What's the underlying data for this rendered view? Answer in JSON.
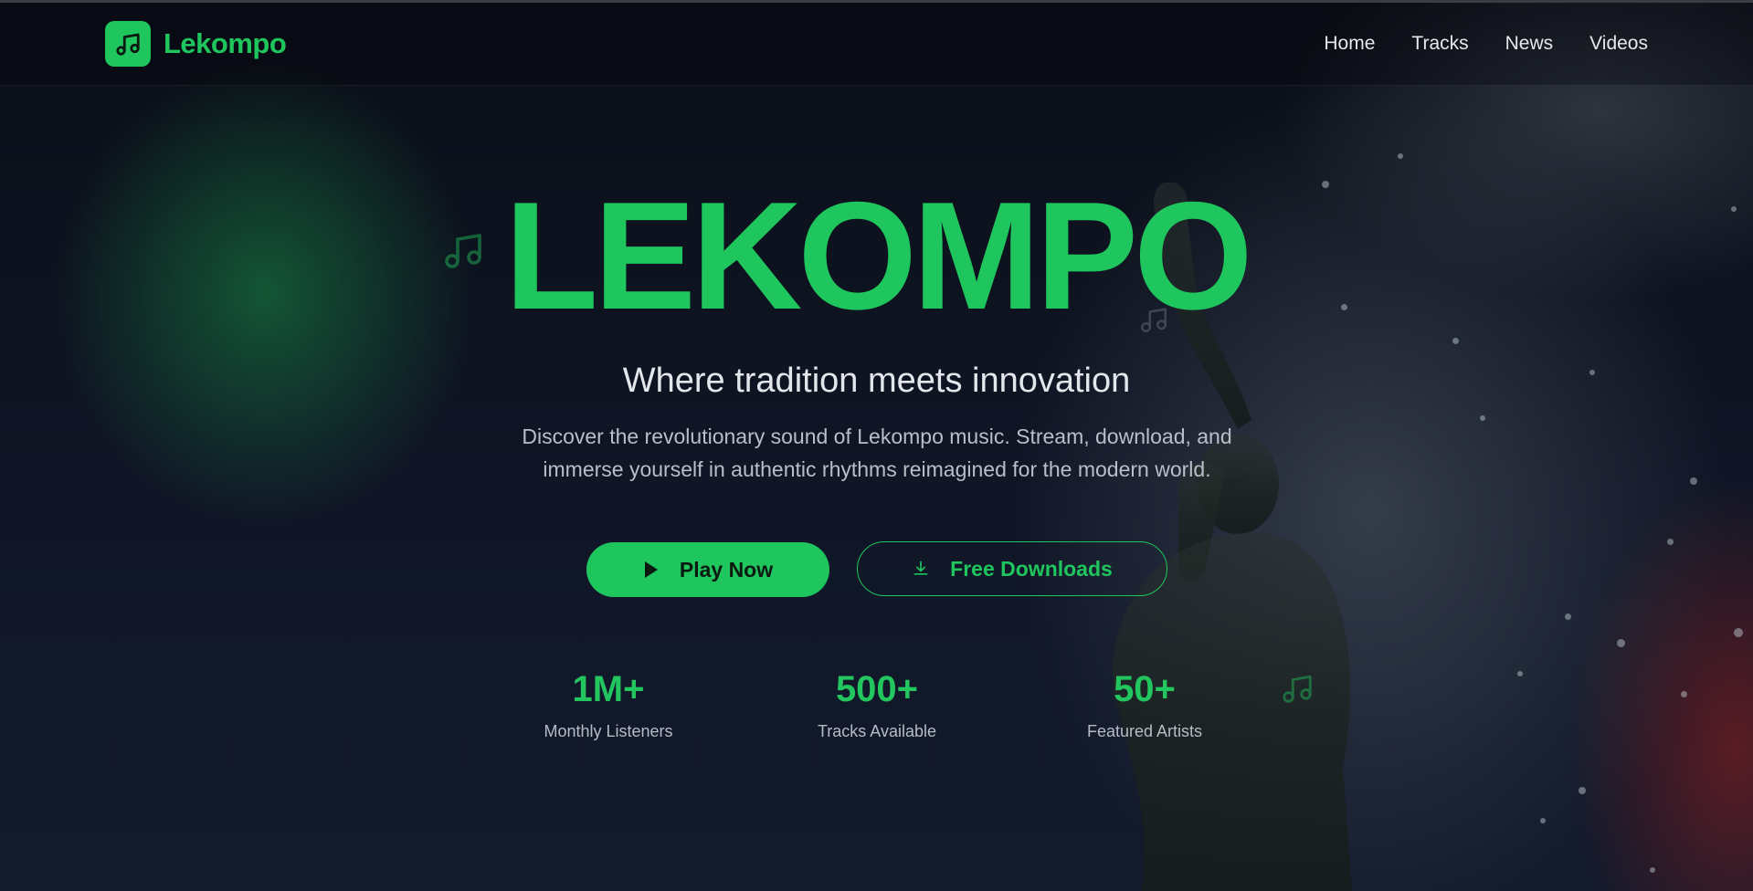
{
  "brand": {
    "name": "Lekompo",
    "accent_color": "#1fc55d",
    "logo_icon": "music-note-icon"
  },
  "nav": {
    "items": [
      {
        "label": "Home"
      },
      {
        "label": "Tracks"
      },
      {
        "label": "News"
      },
      {
        "label": "Videos"
      }
    ]
  },
  "hero": {
    "title": "LEKOMPO",
    "tagline": "Where tradition meets innovation",
    "description": "Discover the revolutionary sound of Lekompo music. Stream, download, and immerse yourself in authentic rhythms reimagined for the modern world.",
    "play_button": {
      "label": "Play Now",
      "icon": "play-icon"
    },
    "download_button": {
      "label": "Free Downloads",
      "icon": "download-icon"
    }
  },
  "stats": [
    {
      "value": "1M+",
      "label": "Monthly Listeners"
    },
    {
      "value": "500+",
      "label": "Tracks Available"
    },
    {
      "value": "50+",
      "label": "Featured Artists"
    }
  ]
}
